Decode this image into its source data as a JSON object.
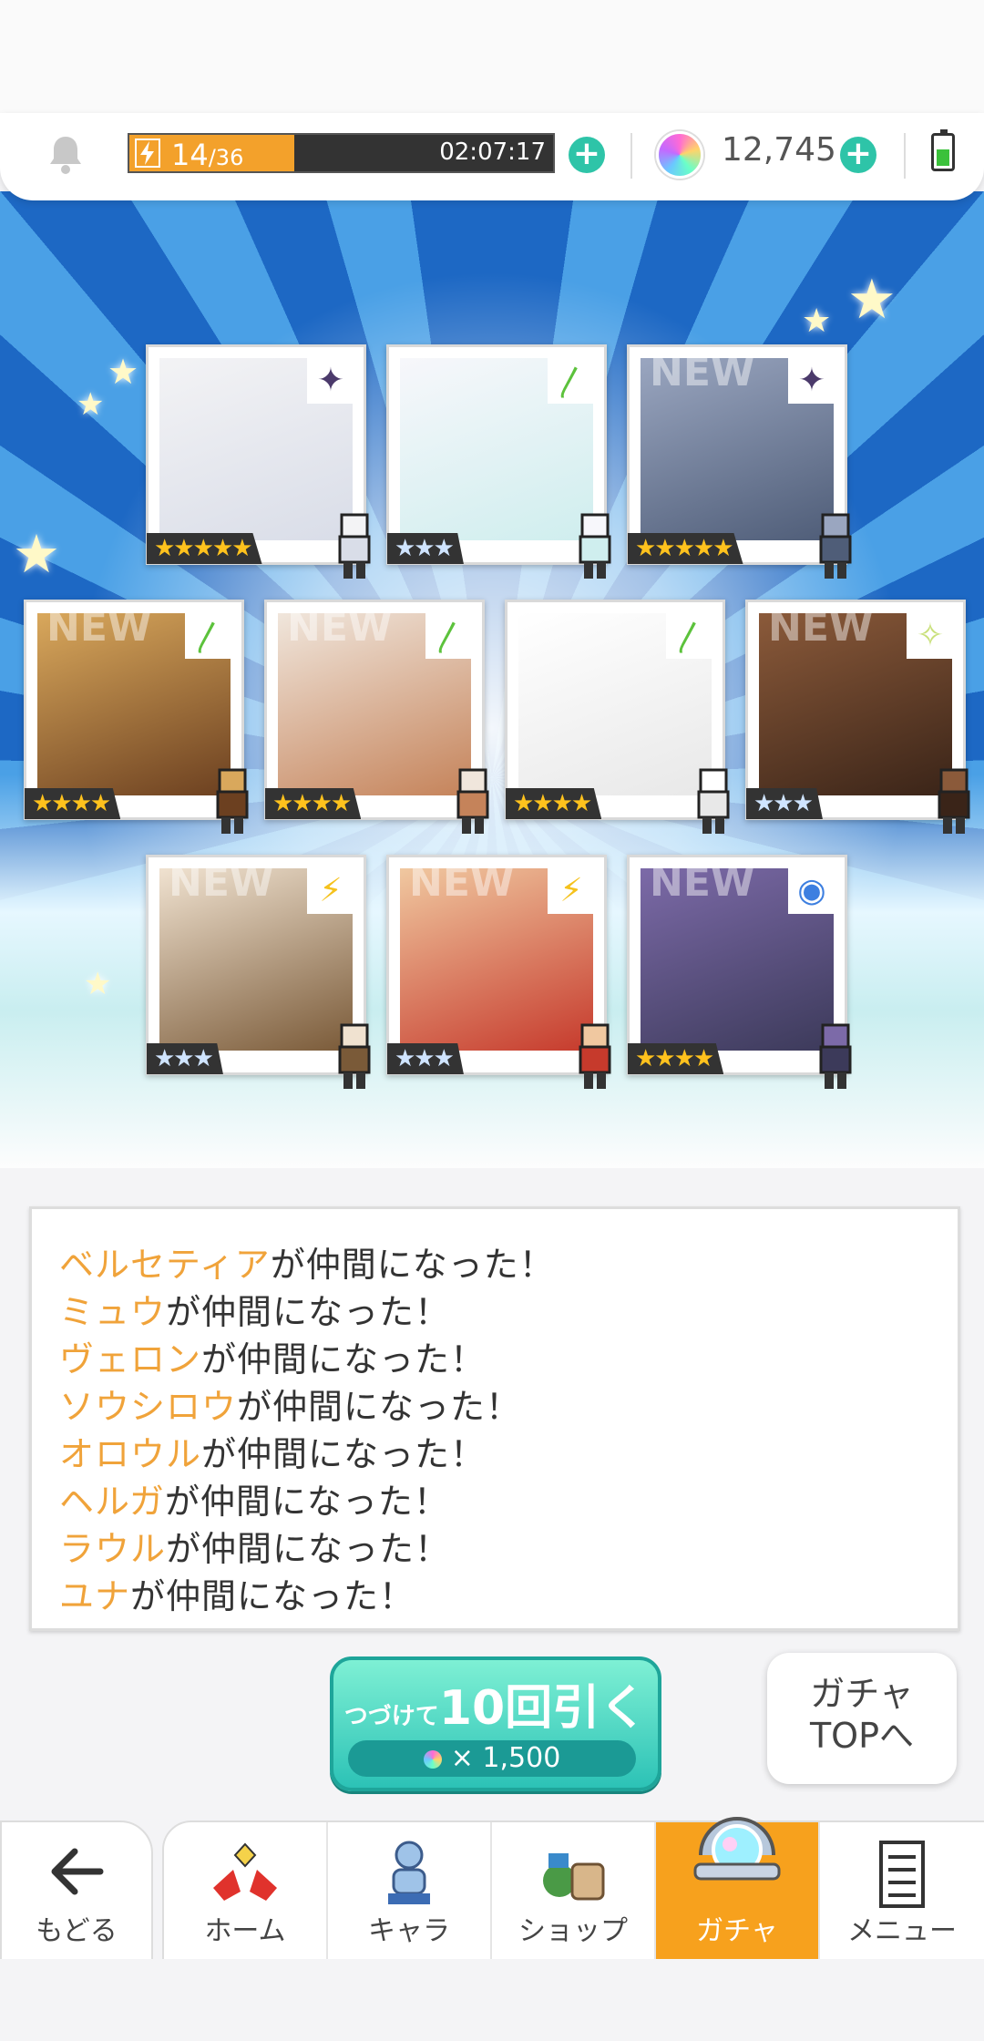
{
  "status": {
    "stamina_current": "14",
    "stamina_max": "/36",
    "stamina_fraction": 0.389,
    "stamina_timer": "02:07:17",
    "gems": "12,745",
    "colors": {
      "stamina": "#f3a12b",
      "plus": "#2ec4a8",
      "active_tab": "#f7a11d",
      "name_highlight": "#f0a33a"
    }
  },
  "cards": [
    {
      "rarity": "★★★★★",
      "element": "dark",
      "is_new": false,
      "new_label": ""
    },
    {
      "rarity": "★★★",
      "element": "wind",
      "is_new": false,
      "new_label": ""
    },
    {
      "rarity": "★★★★★",
      "element": "dark",
      "is_new": true,
      "new_label": "NEW"
    },
    {
      "rarity": "★★★★",
      "element": "wind",
      "is_new": true,
      "new_label": "NEW"
    },
    {
      "rarity": "★★★★",
      "element": "wind",
      "is_new": true,
      "new_label": "NEW"
    },
    {
      "rarity": "★★★★",
      "element": "wind",
      "is_new": false,
      "new_label": ""
    },
    {
      "rarity": "★★★",
      "element": "light",
      "is_new": true,
      "new_label": "NEW"
    },
    {
      "rarity": "★★★",
      "element": "thunder",
      "is_new": true,
      "new_label": "NEW"
    },
    {
      "rarity": "★★★",
      "element": "thunder",
      "is_new": true,
      "new_label": "NEW"
    },
    {
      "rarity": "★★★★",
      "element": "water",
      "is_new": true,
      "new_label": "NEW"
    }
  ],
  "messages": [
    {
      "name": "ベルセティア",
      "suffix": "が仲間になった！"
    },
    {
      "name": "ミュウ",
      "suffix": "が仲間になった！"
    },
    {
      "name": "ヴェロン",
      "suffix": "が仲間になった！"
    },
    {
      "name": "ソウシロウ",
      "suffix": "が仲間になった！"
    },
    {
      "name": "オロウル",
      "suffix": "が仲間になった！"
    },
    {
      "name": "ヘルガ",
      "suffix": "が仲間になった！"
    },
    {
      "name": "ラウル",
      "suffix": "が仲間になった！"
    },
    {
      "name": "ユナ",
      "suffix": "が仲間になった！"
    }
  ],
  "pull_button": {
    "prefix": "つづけて",
    "main": "10回引く",
    "cost": "× 1,500"
  },
  "top_button": {
    "line1": "ガチャ",
    "line2": "TOPへ"
  },
  "nav": {
    "back": "もどる",
    "tabs": [
      "ホーム",
      "キャラ",
      "ショップ",
      "ガチャ",
      "メニュー"
    ],
    "active": "ガチャ"
  }
}
